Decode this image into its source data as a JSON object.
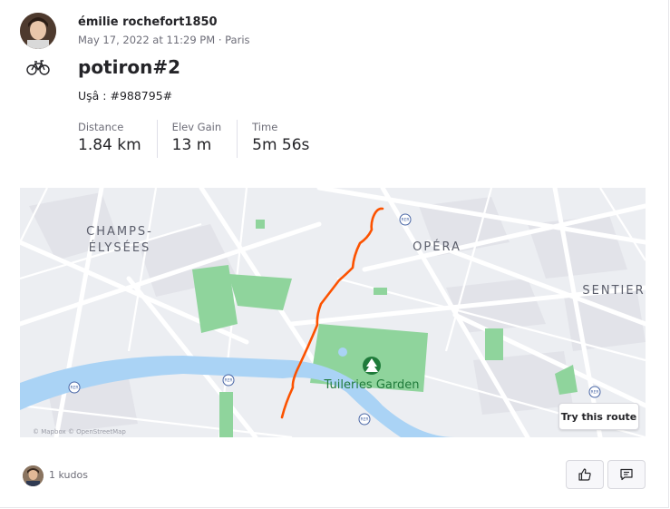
{
  "activity": {
    "athlete_name": "émilie rochefort1850",
    "timestamp": "May 17, 2022 at 11:29 PM · Paris",
    "sport_icon": "bike-icon",
    "title": "potiron#2",
    "description": "Uşâ : #988795#"
  },
  "stats": [
    {
      "label": "Distance",
      "value": "1.84 km"
    },
    {
      "label": "Elev Gain",
      "value": "13 m"
    },
    {
      "label": "Time",
      "value": "5m 56s"
    }
  ],
  "map": {
    "labels": {
      "champs_line1": "CHAMPS-",
      "champs_line2": "ÉLYSÉES",
      "opera": "OPÉRA",
      "sentier": "SENTIER",
      "tuileries": "Tuileries Garden"
    },
    "rer_badge": "RER",
    "attribution": "© Mapbox © OpenStreetMap",
    "try_route_label": "Try this route",
    "route_color": "#fc5200",
    "park_color": "#8fd49c",
    "water_color": "#aad3f5"
  },
  "footer": {
    "kudos_text": "1 kudos",
    "kudos_icon": "thumbs-up-icon",
    "comment_icon": "comment-icon"
  }
}
